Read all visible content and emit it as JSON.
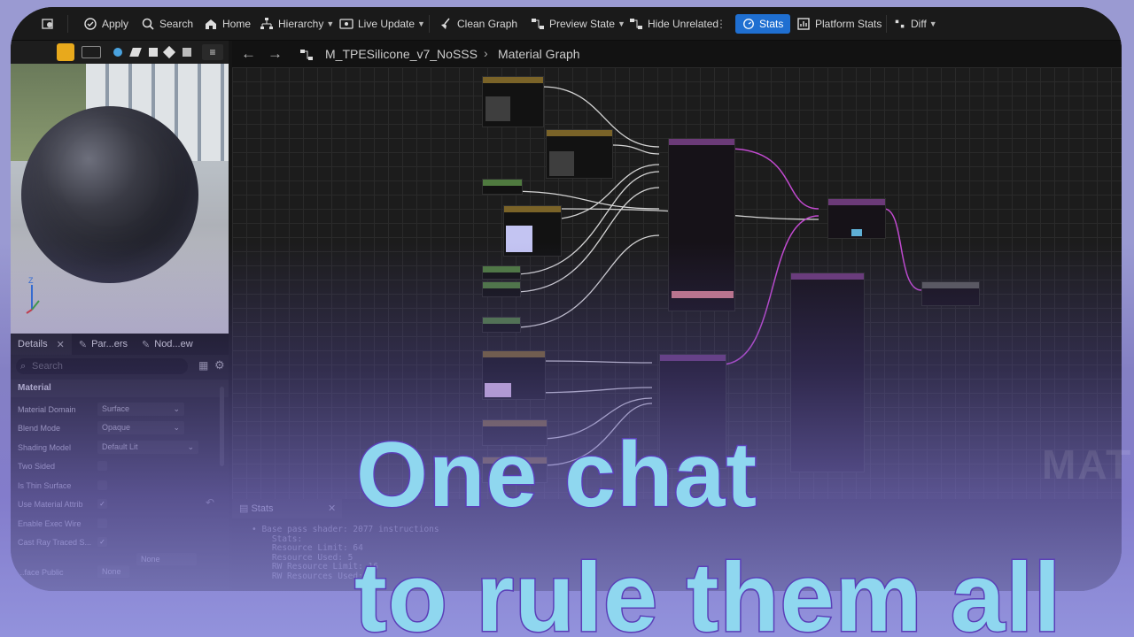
{
  "toolbar": {
    "apply": "Apply",
    "search": "Search",
    "home": "Home",
    "hierarchy": "Hierarchy",
    "live_update": "Live Update",
    "clean_graph": "Clean Graph",
    "preview_state": "Preview State",
    "hide_unrelated": "Hide Unrelated",
    "stats": "Stats",
    "platform_stats": "Platform Stats",
    "diff": "Diff"
  },
  "graph": {
    "breadcrumb_asset": "M_TPESilicone_v7_NoSSS",
    "breadcrumb_page": "Material Graph",
    "watermark": "MAT"
  },
  "details": {
    "tabs": [
      "Details",
      "Par...ers",
      "Nod...ew"
    ],
    "search_placeholder": "Search",
    "section": "Material",
    "props": [
      {
        "label": "Material Domain",
        "value": "Surface"
      },
      {
        "label": "Blend Mode",
        "value": "Opaque"
      },
      {
        "label": "Shading Model",
        "value": "Default Lit"
      },
      {
        "label": "Two Sided",
        "value": ""
      },
      {
        "label": "Is Thin Surface",
        "value": ""
      },
      {
        "label": "Use Material Attrib",
        "value": ""
      },
      {
        "label": "Enable Exec Wire",
        "value": ""
      },
      {
        "label": "Cast Ray Traced S...",
        "value": ""
      },
      {
        "label": "...face Public",
        "value": "None"
      }
    ],
    "extra_value": "None"
  },
  "stats": {
    "tab": "Stats",
    "lines": [
      "• Base pass shader: 2077 instructions",
      "    Stats:",
      "    Resource Limit: 64",
      "    Resource Used: 5",
      "    RW Resource Limit: 16",
      "    RW Resources Used: 0"
    ]
  },
  "headline": {
    "line1": "One chat",
    "line2": "to rule them all"
  },
  "colors": {
    "accent": "#1f6fd1",
    "headline_fill": "#8fd7ef",
    "headline_stroke": "#5b3fb8",
    "wire_pink": "#c24ad0",
    "background": "#9a9ad2"
  }
}
